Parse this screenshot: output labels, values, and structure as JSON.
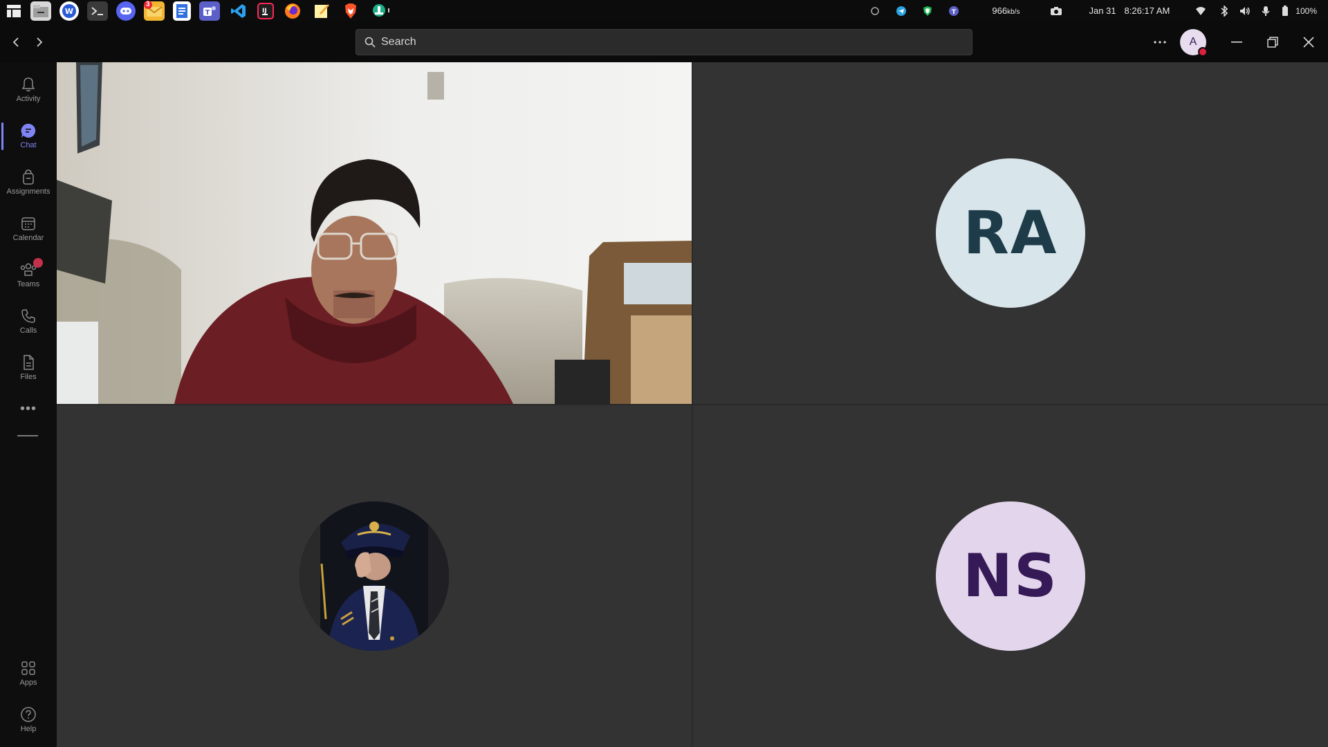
{
  "system_bar": {
    "apps": [
      "app-menu",
      "file-manager",
      "word",
      "terminal",
      "discord",
      "mail",
      "docs",
      "teams",
      "vscode",
      "jetbrains",
      "firefox",
      "notes",
      "brave",
      "tray-app"
    ],
    "mail_badge": "3",
    "network_speed": "966",
    "network_unit": "kb/s",
    "date": "Jan 31",
    "time": "8:26:17 AM",
    "battery": "100%"
  },
  "titlebar": {
    "search_placeholder": "Search",
    "avatar_initial": "A",
    "presence_color": "#d9213f"
  },
  "rail": {
    "items": [
      {
        "label": "Activity",
        "icon": "bell-icon"
      },
      {
        "label": "Chat",
        "icon": "chat-icon",
        "active": true
      },
      {
        "label": "Assignments",
        "icon": "bag-icon"
      },
      {
        "label": "Calendar",
        "icon": "calendar-icon"
      },
      {
        "label": "Teams",
        "icon": "teams-icon"
      },
      {
        "label": "Calls",
        "icon": "phone-icon"
      },
      {
        "label": "Files",
        "icon": "file-icon"
      }
    ],
    "bottom": [
      {
        "label": "Apps",
        "icon": "apps-icon"
      },
      {
        "label": "Help",
        "icon": "help-icon"
      }
    ],
    "accent": "#7f85f5"
  },
  "participants": [
    {
      "type": "video"
    },
    {
      "type": "initials",
      "initials": "RA",
      "bg": "#d8e5ea",
      "fg": "#1d3b48"
    },
    {
      "type": "photo"
    },
    {
      "type": "initials",
      "initials": "NS",
      "bg": "#e3d5ec",
      "fg": "#361a57"
    }
  ]
}
